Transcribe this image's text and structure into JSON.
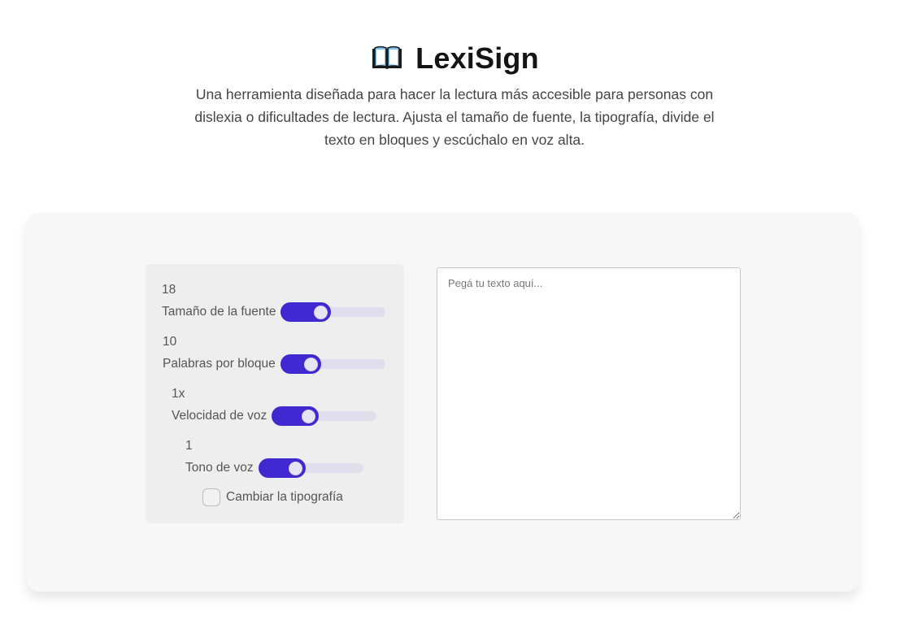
{
  "header": {
    "icon": "open-book-icon",
    "title": "LexiSign",
    "description": "Una herramienta diseñada para hacer la lectura más accesible para personas con dislexia o dificultades de lectura. Ajusta el tamaño de fuente, la tipografía, divide el texto en bloques y escúchalo en voz alta."
  },
  "controls": {
    "font_size": {
      "value": "18",
      "label": "Tamaño de la fuente",
      "fraction": 0.48
    },
    "words_per_block": {
      "value": "10",
      "label": "Palabras por bloque",
      "fraction": 0.39
    },
    "speech_rate": {
      "value": "1x",
      "label": "Velocidad de voz",
      "fraction": 0.45
    },
    "pitch": {
      "value": "1",
      "label": "Tono de voz",
      "fraction": 0.45
    },
    "font_toggle": {
      "label": "Cambiar la tipografía",
      "checked": false
    }
  },
  "editor": {
    "placeholder": "Pegá tu texto aquí...",
    "value": ""
  },
  "colors": {
    "accent": "#4129d2",
    "track": "#e0ddec",
    "panel": "#eeeeee",
    "card": "#f7f7f7"
  }
}
